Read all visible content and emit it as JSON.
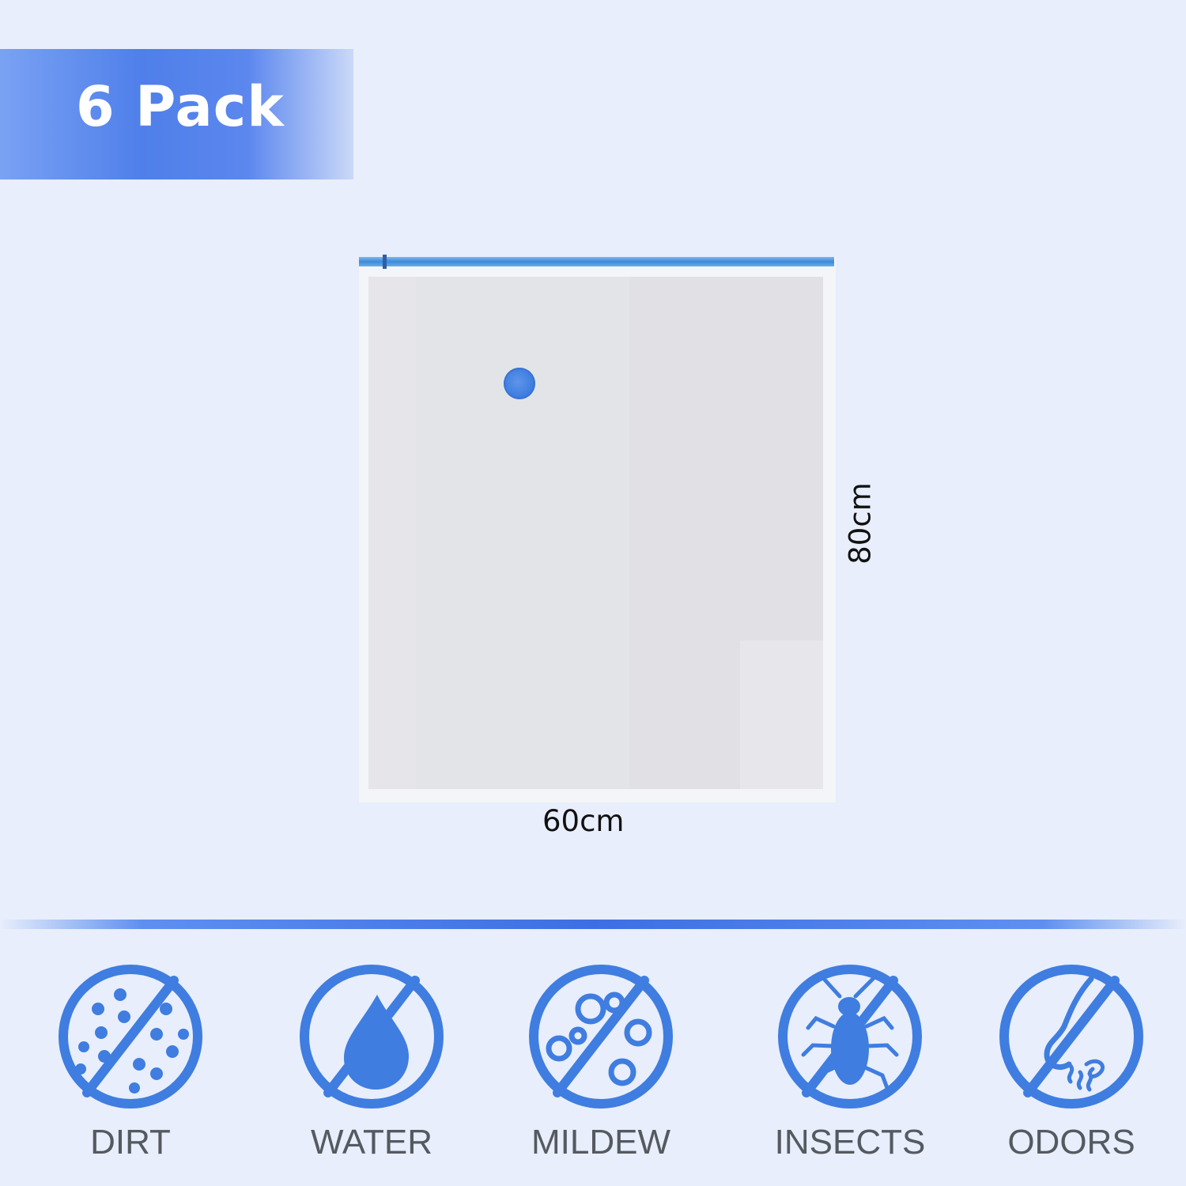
{
  "pack": {
    "label": "6 Pack"
  },
  "bag": {
    "width_label": "60cm",
    "height_label": "80cm"
  },
  "colors": {
    "accent": "#3f7de0",
    "background": "#e8eefb",
    "label": "#555a60"
  },
  "features": [
    {
      "label": "DIRT",
      "icon": "no-dirt-icon"
    },
    {
      "label": "WATER",
      "icon": "no-water-icon"
    },
    {
      "label": "MILDEW",
      "icon": "no-mildew-icon"
    },
    {
      "label": "INSECTS",
      "icon": "no-insects-icon"
    },
    {
      "label": "ODORS",
      "icon": "no-odors-icon"
    }
  ]
}
